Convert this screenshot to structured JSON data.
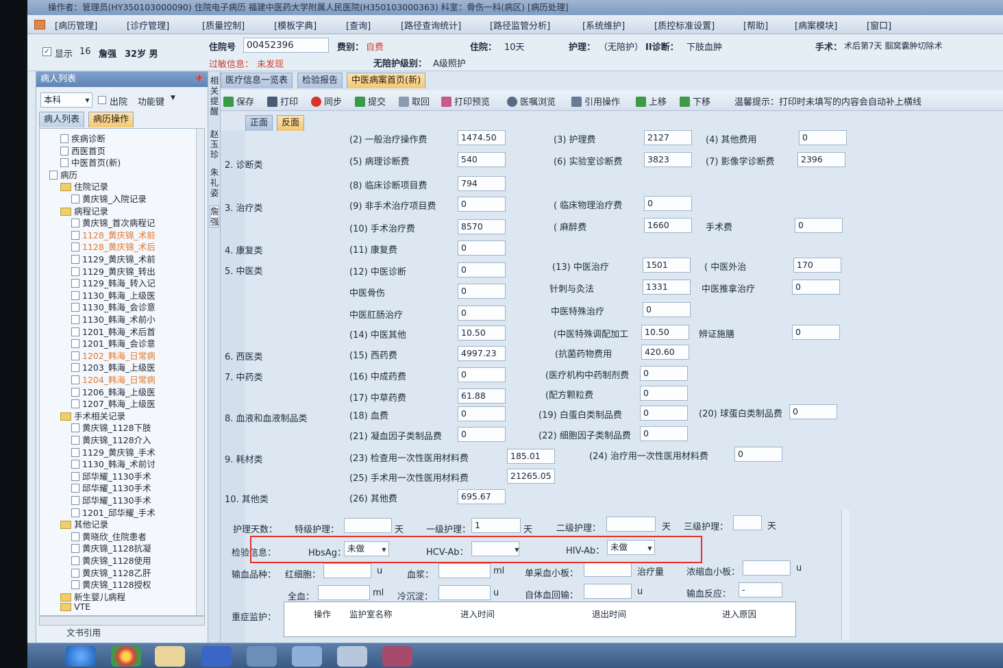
{
  "window": {
    "title": "操作者：管理员(HY350103000090) 住院电子病历  福建中医药大学附属人民医院(H350103000363)  科室：骨伤一科(病区)  [病历处理]"
  },
  "menu": [
    "[病历管理]",
    "[诊疗管理]",
    "[质量控制]",
    "[模板字典]",
    "[查询]",
    "[路径查询统计]",
    "[路径监管分析]",
    "[系统维护]",
    "[质控标准设置]",
    "[帮助]",
    "[病案模块]",
    "[窗口]"
  ],
  "patient": {
    "show_label": "显示",
    "bed": "16",
    "name": "詹强",
    "age_sex": "32岁 男",
    "admission_no_label": "住院号",
    "admission_no": "00452396",
    "fee_type_label": "费别：",
    "fee_type": "自费",
    "stay_label": "住院：",
    "stay": "10天",
    "nursing_label": "护理：",
    "nursing": "（无陪护）",
    "diagnosis_label": "II诊断：",
    "diagnosis": "下肢血肿",
    "surgery_label": "手术：",
    "surgery": "术后第7天  腘窝囊肿切除术",
    "allergy_label": "过敏信息：",
    "allergy": "未发现",
    "no_escort_label": "无陪护级别：",
    "no_escort": "A级照护"
  },
  "left_panel": {
    "title": "病人列表",
    "dept": "本科",
    "discharge": "出院",
    "func": "功能键",
    "tabs": [
      "病人列表",
      "病历操作"
    ],
    "tree": [
      {
        "label": "疾病诊断",
        "style": "normal"
      },
      {
        "label": "西医首页",
        "style": "normal"
      },
      {
        "label": "中医首页(新)",
        "style": "normal"
      },
      {
        "label": "病历",
        "style": "normal"
      },
      {
        "label": "住院记录",
        "style": "folder"
      },
      {
        "label": "黄庆锦_入院记录",
        "style": "normal"
      },
      {
        "label": "病程记录",
        "style": "folder"
      },
      {
        "label": "黄庆锦_首次病程记",
        "style": "normal"
      },
      {
        "label": "1128_黄庆锦_术前",
        "style": "orange"
      },
      {
        "label": "1128_黄庆锦_术后",
        "style": "orange"
      },
      {
        "label": "1129_黄庆锦_术前",
        "style": "normal"
      },
      {
        "label": "1129_黄庆锦_转出",
        "style": "normal"
      },
      {
        "label": "1129_韩海_转入记",
        "style": "normal"
      },
      {
        "label": "1130_韩海_上级医",
        "style": "normal"
      },
      {
        "label": "1130_韩海_会诊意",
        "style": "normal"
      },
      {
        "label": "1130_韩海_术前小",
        "style": "normal"
      },
      {
        "label": "1201_韩海_术后首",
        "style": "normal"
      },
      {
        "label": "1201_韩海_会诊意",
        "style": "normal"
      },
      {
        "label": "1202_韩海_日常病",
        "style": "orange"
      },
      {
        "label": "1203_韩海_上级医",
        "style": "normal"
      },
      {
        "label": "1204_韩海_日常病",
        "style": "orange"
      },
      {
        "label": "1206_韩海_上级医",
        "style": "normal"
      },
      {
        "label": "1207_韩海_上级医",
        "style": "normal"
      },
      {
        "label": "手术相关记录",
        "style": "folder"
      },
      {
        "label": "黄庆锦_1128下肢",
        "style": "normal"
      },
      {
        "label": "黄庆锦_1128介入",
        "style": "normal"
      },
      {
        "label": "1129_黄庆锦_手术",
        "style": "normal"
      },
      {
        "label": "1130_韩海_术前讨",
        "style": "normal"
      },
      {
        "label": "邱华耀_1130手术",
        "style": "normal"
      },
      {
        "label": "邱华耀_1130手术",
        "style": "normal"
      },
      {
        "label": "邱华耀_1130手术",
        "style": "normal"
      },
      {
        "label": "1201_邱华耀_手术",
        "style": "normal"
      },
      {
        "label": "其他记录",
        "style": "folder"
      },
      {
        "label": "黄晓欣_住院患者",
        "style": "normal"
      },
      {
        "label": "黄庆锦_1128抗凝",
        "style": "normal"
      },
      {
        "label": "黄庆锦_1128使用",
        "style": "normal"
      },
      {
        "label": "黄庆锦_1128乙肝",
        "style": "normal"
      },
      {
        "label": "黄庆锦_1128授权",
        "style": "normal"
      },
      {
        "label": "新生婴儿病程",
        "style": "folder"
      },
      {
        "label": "VTE",
        "style": "folder"
      }
    ],
    "bottom": "文书引用"
  },
  "side_strip": [
    "相关提醒",
    "赵玉珍",
    "朱礼姿",
    "詹强"
  ],
  "tabs": [
    "医疗信息一览表",
    "检验报告",
    "中医病案首页(新)"
  ],
  "toolbar": {
    "buttons": [
      "保存",
      "打印",
      "同步",
      "提交",
      "取回",
      "打印预览",
      "医嘱浏览",
      "引用操作",
      "上移",
      "下移"
    ],
    "hint": "温馨提示：打印时未填写的内容会自动补上横线"
  },
  "subtabs": [
    "正面",
    "反面"
  ],
  "form": {
    "sections": [
      "2. 诊断类",
      "3. 治疗类",
      "4. 康复类",
      "5. 中医类",
      "6. 西医类",
      "7. 中药类",
      "8. 血液和血液制品类",
      "9. 耗材类",
      "10. 其他类"
    ],
    "fields": {
      "f2": {
        "label": "(2) 一般治疗操作费",
        "value": "1474.50"
      },
      "f3": {
        "label": "(3) 护理费",
        "value": "2127"
      },
      "f4": {
        "label": "(4) 其他费用",
        "value": "0"
      },
      "f5": {
        "label": "(5) 病理诊断费",
        "value": "540"
      },
      "f6": {
        "label": "(6) 实验室诊断费",
        "value": "3823"
      },
      "f7": {
        "label": "(7) 影像学诊断费",
        "value": "2396"
      },
      "f8": {
        "label": "(8) 临床诊断项目费",
        "value": "794"
      },
      "f9": {
        "label": "(9) 非手术治疗项目费",
        "value": "0"
      },
      "f9a": {
        "label": "( 临床物理治疗费",
        "value": "0"
      },
      "f10": {
        "label": "(10) 手术治疗费",
        "value": "8570"
      },
      "f10a": {
        "label": "( 麻醉费",
        "value": "1660"
      },
      "f10b": {
        "label": "手术费",
        "value": "0"
      },
      "f11": {
        "label": "(11) 康复费",
        "value": "0"
      },
      "f12": {
        "label": "(12) 中医诊断",
        "value": "0"
      },
      "f13": {
        "label": "(13) 中医治疗",
        "value": "1501"
      },
      "f13a": {
        "label": "( 中医外治",
        "value": "170"
      },
      "f12a": {
        "label": "中医骨伤",
        "value": "0"
      },
      "f13b": {
        "label": "针刺与灸法",
        "value": "1331"
      },
      "f13c": {
        "label": "中医推拿治疗",
        "value": "0"
      },
      "f12b": {
        "label": "中医肛肠治疗",
        "value": "0"
      },
      "f13d": {
        "label": "中医特殊治疗",
        "value": "0"
      },
      "f14": {
        "label": "(14) 中医其他",
        "value": "10.50"
      },
      "f14a": {
        "label": "(中医特殊调配加工",
        "value": "10.50"
      },
      "f14b": {
        "label": "辨证施膳",
        "value": "0"
      },
      "f15": {
        "label": "(15) 西药费",
        "value": "4997.23"
      },
      "f15a": {
        "label": "(抗菌药物费用",
        "value": "420.60"
      },
      "f16": {
        "label": "(16) 中成药费",
        "value": "0"
      },
      "f16a": {
        "label": "(医疗机构中药制剂费",
        "value": "0"
      },
      "f17": {
        "label": "(17) 中草药费",
        "value": "61.88"
      },
      "f17a": {
        "label": "(配方颗粒费",
        "value": "0"
      },
      "f18": {
        "label": "(18) 血费",
        "value": "0"
      },
      "f19": {
        "label": "(19) 白蛋白类制品费",
        "value": "0"
      },
      "f20": {
        "label": "(20) 球蛋白类制品费",
        "value": "0"
      },
      "f21": {
        "label": "(21) 凝血因子类制品费",
        "value": "0"
      },
      "f22": {
        "label": "(22) 细胞因子类制品费",
        "value": "0"
      },
      "f23": {
        "label": "(23) 检查用一次性医用材料费",
        "value": "185.01"
      },
      "f24": {
        "label": "(24) 治疗用一次性医用材料费",
        "value": "0"
      },
      "f25": {
        "label": "(25) 手术用一次性医用材料费",
        "value": "21265.05"
      },
      "f26": {
        "label": "(26) 其他费",
        "value": "695.67"
      }
    },
    "nursing_days": {
      "label": "护理天数：",
      "special": "特级护理：",
      "first": "一级护理：",
      "first_value": "1",
      "second": "二级护理：",
      "third": "三级护理：",
      "unit": "天"
    },
    "exam": {
      "label": "检验信息：",
      "hbsag": "HbsAg：",
      "hbsag_value": "未做",
      "hcv": "HCV-Ab：",
      "hcv_value": "",
      "hiv": "HIV-Ab：",
      "hiv_value": "未做"
    },
    "transfusion": {
      "label": "输血品种：",
      "rbc": "红细胞：",
      "rbc_unit": "u",
      "plasma": "血浆：",
      "plasma_unit": "ml",
      "platelet": "单采血小板：",
      "platelet_unit": "治疗量",
      "conc_platelet": "浓缩血小板：",
      "conc_unit": "u",
      "whole": "全血：",
      "whole_unit": "ml",
      "cryo": "冷沉淀：",
      "cryo_unit": "u",
      "auto": "自体血回输：",
      "auto_unit": "u",
      "reaction": "输血反应：",
      "reaction_value": "-"
    },
    "icu": {
      "label": "重症监护：",
      "cols": [
        "操作",
        "监护室名称",
        "进入时间",
        "退出时间",
        "进入原因"
      ]
    }
  }
}
